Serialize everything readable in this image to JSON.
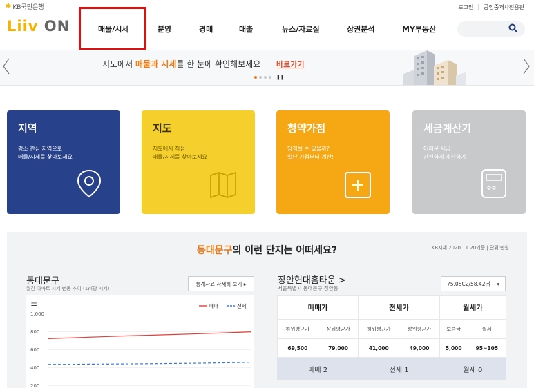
{
  "header": {
    "bank_logo": "KB국민은행",
    "brand_logo": {
      "part1": "Liiv",
      "part2": "ON"
    },
    "top_links": [
      "로그인",
      "공인중개사전용관"
    ],
    "nav": [
      "매물/시세",
      "분양",
      "경매",
      "대출",
      "뉴스/자료실",
      "상권분석",
      "MY부동산"
    ]
  },
  "banner": {
    "text_before": "지도에서 ",
    "text_highlight": "매물과 시세",
    "text_after": "를 한 눈에 확인해보세요",
    "link": "바로가기"
  },
  "cards": [
    {
      "title": "지역",
      "desc1": "평소 관심 지역으로",
      "desc2": "매물/시세를 찾아보세요",
      "icon": "location-pin-icon"
    },
    {
      "title": "지도",
      "desc1": "지도에서 직접",
      "desc2": "매물/시세를 찾아보세요",
      "icon": "map-icon"
    },
    {
      "title": "청약가점",
      "desc1": "당첨될 수 있을까?",
      "desc2": "일단 가점부터 계산!",
      "icon": "plus-calculator-icon"
    },
    {
      "title": "세금계산기",
      "desc1": "어려운 세금",
      "desc2": "간편하게 계산하기",
      "icon": "calculator-icon"
    }
  ],
  "panel": {
    "title_highlight": "동대문구",
    "title_rest": "의 이런 단지는 어떠세요?",
    "meta": "KB시세 2020.11.20기준 | 단위:만원"
  },
  "chart_panel": {
    "title": "동대문구",
    "subtitle": "월간 아파트 시세 변동 추이 (1㎡당 시세)",
    "button": "통계자료 자세히 보기 ▸",
    "menu_icon": "≡"
  },
  "chart_data": {
    "type": "line",
    "y_ticks": [
      "1,000",
      "800",
      "600",
      "400",
      "200"
    ],
    "ylim": [
      200,
      1000
    ],
    "series": [
      {
        "name": "매매",
        "color": "#e0403a",
        "style": "solid",
        "values": [
          720,
          730,
          740,
          750,
          758,
          766,
          775,
          785,
          795
        ]
      },
      {
        "name": "전세",
        "color": "#3a78d8",
        "style": "dashed",
        "values": [
          432,
          434,
          436,
          438,
          440,
          443,
          446,
          451,
          456
        ]
      }
    ]
  },
  "complex": {
    "name": "장안현대홈타운",
    "chevron": ">",
    "address": "서울특별시 동대문구 장안동",
    "area": "75.08C2/58.42㎡",
    "headers": [
      "매매가",
      "전세가",
      "월세가"
    ],
    "subheaders": [
      "하위평균가",
      "상위평균가",
      "하위평균가",
      "상위평균가",
      "보증금",
      "월세"
    ],
    "values": [
      "69,500",
      "79,000",
      "41,000",
      "49,000",
      "5,000",
      "95~105"
    ],
    "counts": [
      "매매 2",
      "전세 1",
      "월세 0"
    ]
  }
}
